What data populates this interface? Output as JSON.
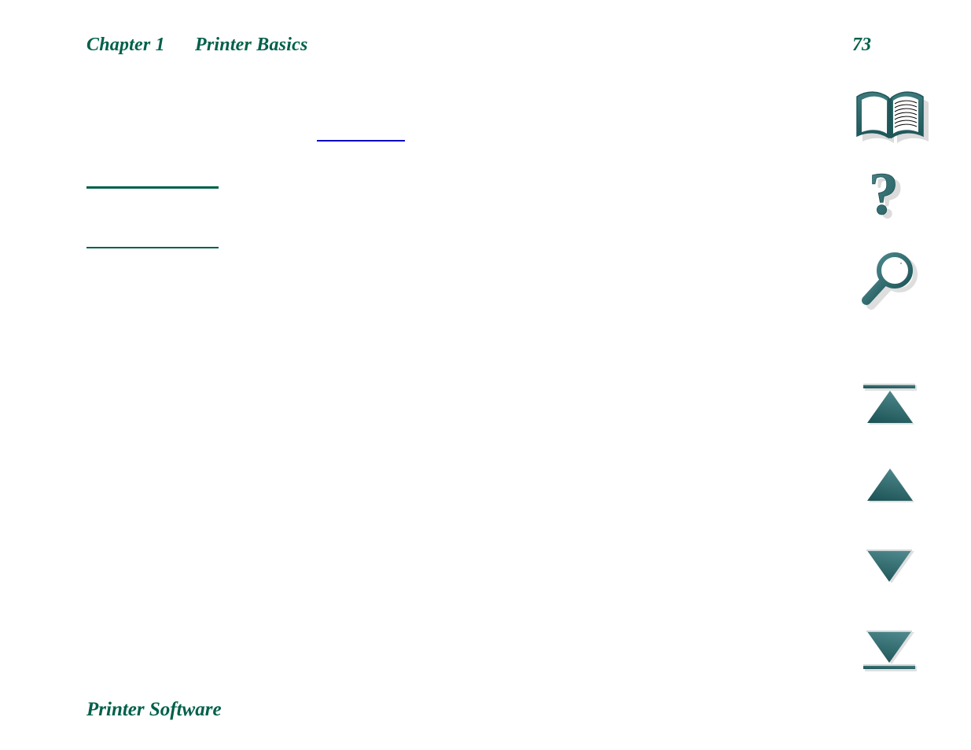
{
  "document": {
    "page_background": "#ffffff",
    "accent_green": "#00604a",
    "accent_teal": "#2f6a6e",
    "link_blue": "#0000c8"
  },
  "header": {
    "chapter_label": "Chapter 1",
    "chapter_title": "Printer Basics",
    "page_number": "73"
  },
  "body": {
    "links": [
      {
        "id": "link-top",
        "label": "",
        "color": "#0000c8"
      },
      {
        "id": "rule-one",
        "label": "",
        "color": "#00604a"
      },
      {
        "id": "rule-two",
        "label": "",
        "color": "#00604a"
      }
    ],
    "section_heading": "Printer Software"
  },
  "nav_rail": {
    "buttons": [
      {
        "icon": "book-icon",
        "label": "Table of Contents"
      },
      {
        "icon": "question-mark-icon",
        "label": "Help"
      },
      {
        "icon": "magnifying-glass-icon",
        "label": "Search"
      },
      {
        "icon": "first-page-icon",
        "label": "First Page"
      },
      {
        "icon": "previous-page-icon",
        "label": "Previous Page"
      },
      {
        "icon": "next-page-icon",
        "label": "Next Page"
      },
      {
        "icon": "last-page-icon",
        "label": "Last Page"
      }
    ]
  }
}
